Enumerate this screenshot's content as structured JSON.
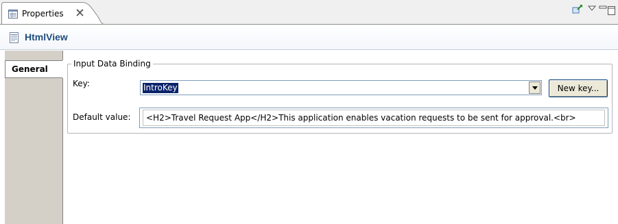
{
  "view_tab": {
    "title": "Properties"
  },
  "header": {
    "title": "HtmlView"
  },
  "tabs": [
    {
      "label": "General"
    }
  ],
  "group": {
    "legend": "Input Data Binding",
    "key_label": "Key:",
    "key_value": "IntroKey",
    "new_key_button": "New key...",
    "default_label": "Default value:",
    "default_value": "<H2>Travel Request App</H2>This application enables vacation requests to be sent for approval.<br>"
  },
  "colors": {
    "accent_title": "#1f4d7e",
    "selection": "#0a246a",
    "tab_column": "#d4d0c8"
  }
}
